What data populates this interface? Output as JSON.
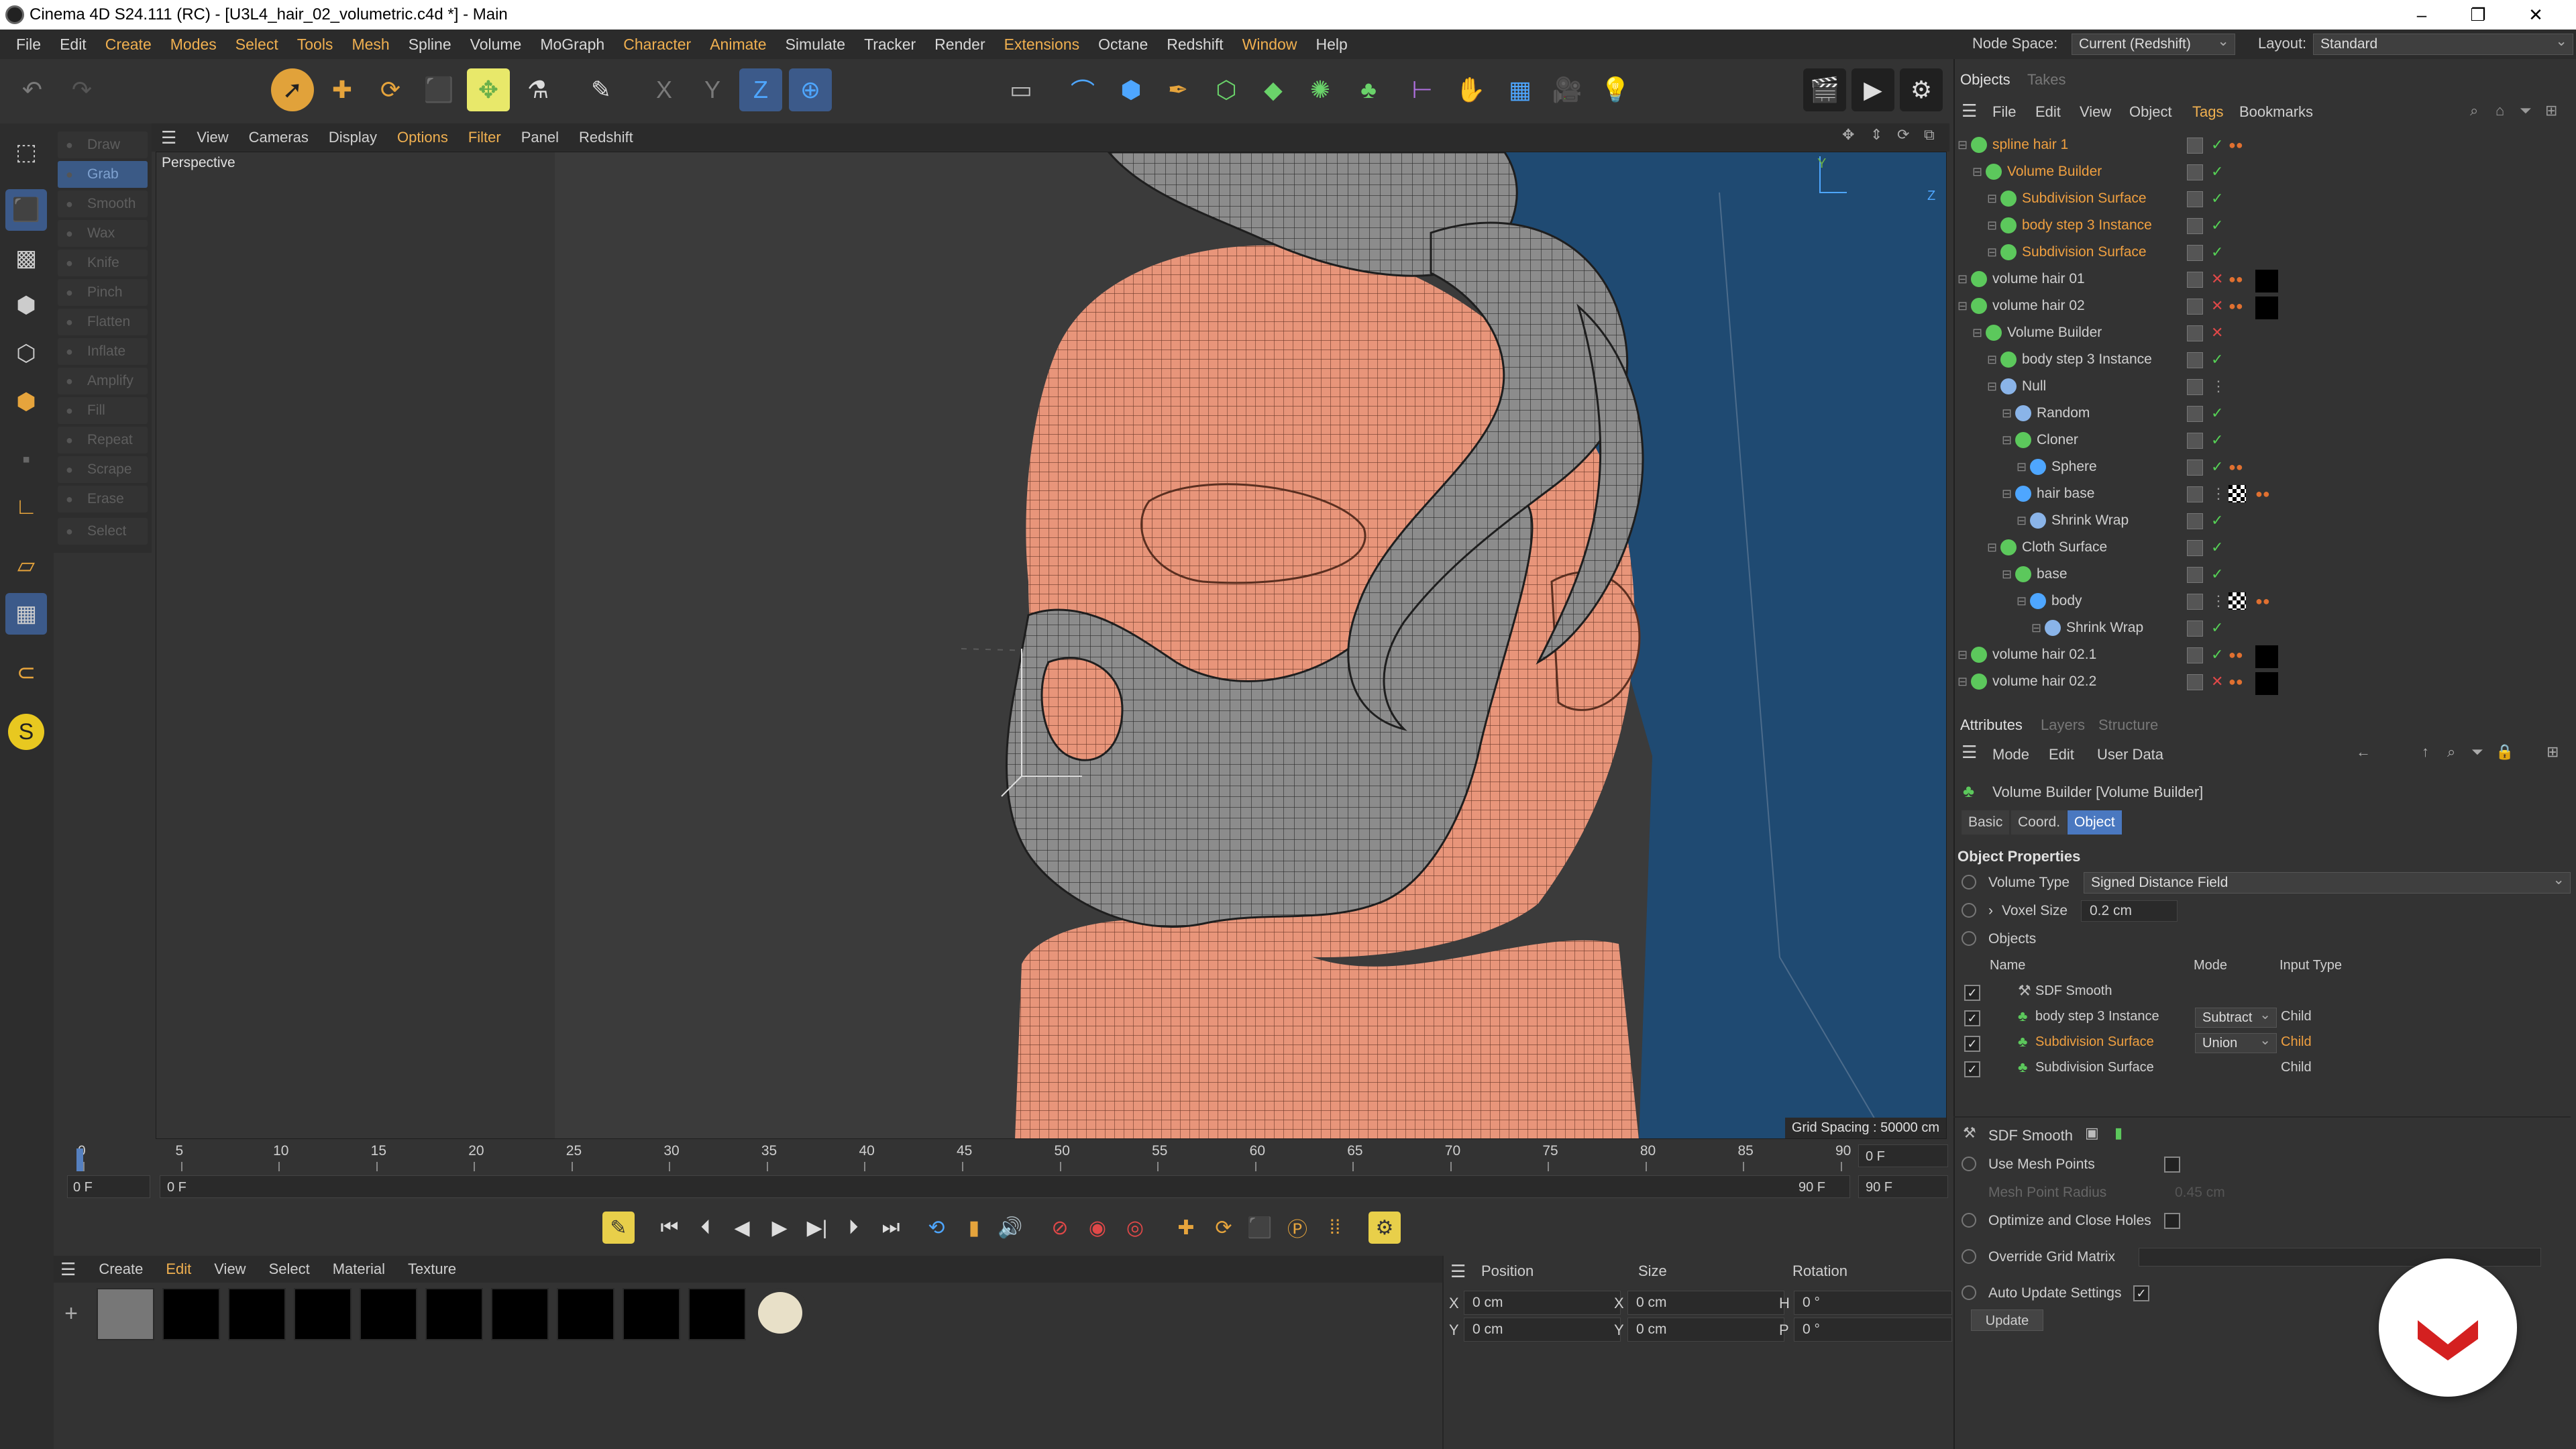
{
  "window": {
    "title": "Cinema 4D S24.111 (RC) - [U3L4_hair_02_volumetric.c4d *] - Main",
    "controls": [
      "–",
      "❐",
      "✕"
    ]
  },
  "menubar": {
    "items": [
      "File",
      "Edit",
      "Create",
      "Modes",
      "Select",
      "Tools",
      "Mesh",
      "Spline",
      "Volume",
      "MoGraph",
      "Character",
      "Animate",
      "Simulate",
      "Tracker",
      "Render",
      "Extensions",
      "Octane",
      "Redshift",
      "Window",
      "Help"
    ],
    "highlighted": [
      "Create",
      "Modes",
      "Character",
      "Extensions",
      "Window"
    ],
    "node_space_label": "Node Space:",
    "node_space_value": "Current (Redshift)",
    "layout_label": "Layout:",
    "layout_value": "Standard"
  },
  "sculpt_tools": [
    "Draw",
    "Grab",
    "Smooth",
    "Wax",
    "Knife",
    "Pinch",
    "Flatten",
    "Inflate",
    "Amplify",
    "Fill",
    "Repeat",
    "Scrape",
    "Erase",
    "Select"
  ],
  "viewport": {
    "menu": [
      "View",
      "Cameras",
      "Display",
      "Options",
      "Filter",
      "Panel",
      "Redshift"
    ],
    "menu_highlighted": [
      "Options",
      "Filter"
    ],
    "label": "Perspective",
    "grid_spacing": "Grid Spacing : 50000 cm",
    "axis_y": "Y",
    "axis_z": "Z"
  },
  "timeline": {
    "ticks": [
      "0",
      "5",
      "10",
      "15",
      "20",
      "25",
      "30",
      "35",
      "40",
      "45",
      "50",
      "55",
      "60",
      "65",
      "70",
      "75",
      "80",
      "85",
      "90"
    ],
    "current_frame": "0 F",
    "start_field": "0 F",
    "range_start": "0 F",
    "range_end": "90 F",
    "end_field": "90 F",
    "end_field2": "90 F"
  },
  "material_manager": {
    "menu": [
      "Create",
      "Edit",
      "View",
      "Select",
      "Material",
      "Texture"
    ],
    "menu_highlighted": [
      "Edit"
    ],
    "add_button": "+"
  },
  "coordinates": {
    "headers": [
      "Position",
      "Size",
      "Rotation"
    ],
    "rows": [
      {
        "axis1": "X",
        "pos": "0 cm",
        "axis2": "X",
        "size": "0 cm",
        "axis3": "H",
        "rot": "0 °"
      },
      {
        "axis1": "Y",
        "pos": "0 cm",
        "axis2": "Y",
        "size": "0 cm",
        "axis3": "P",
        "rot": "0 °"
      }
    ]
  },
  "object_manager": {
    "tabs": [
      "Objects",
      "Takes"
    ],
    "menu": [
      "File",
      "Edit",
      "View",
      "Object",
      "Tags",
      "Bookmarks"
    ],
    "menu_highlighted": [
      "Tags"
    ],
    "objects": [
      {
        "name": "spline hair 1",
        "indent": 0,
        "orange": true,
        "icon": "#5cc85c",
        "state": "check",
        "tags": [
          "dots"
        ]
      },
      {
        "name": "Volume Builder",
        "indent": 1,
        "orange": true,
        "icon": "#5cc85c",
        "state": "check",
        "tags": []
      },
      {
        "name": "Subdivision Surface",
        "indent": 2,
        "orange": true,
        "icon": "#5cc85c",
        "state": "check",
        "tags": []
      },
      {
        "name": "body step 3 Instance",
        "indent": 2,
        "orange": true,
        "icon": "#5cc85c",
        "state": "check",
        "tags": []
      },
      {
        "name": "Subdivision Surface",
        "indent": 2,
        "orange": true,
        "icon": "#5cc85c",
        "state": "check",
        "tags": []
      },
      {
        "name": "volume hair 01",
        "indent": 0,
        "orange": false,
        "icon": "#5cc85c",
        "state": "x",
        "tags": [
          "dots",
          "black"
        ]
      },
      {
        "name": "volume hair 02",
        "indent": 0,
        "orange": false,
        "icon": "#5cc85c",
        "state": "x",
        "tags": [
          "dots",
          "black"
        ]
      },
      {
        "name": "Volume Builder",
        "indent": 1,
        "orange": false,
        "icon": "#5cc85c",
        "state": "x",
        "tags": []
      },
      {
        "name": "body step 3 Instance",
        "indent": 2,
        "orange": false,
        "icon": "#5cc85c",
        "state": "check",
        "tags": []
      },
      {
        "name": "Null",
        "indent": 2,
        "orange": false,
        "icon": "#8ab4e8",
        "state": "none",
        "tags": []
      },
      {
        "name": "Random",
        "indent": 3,
        "orange": false,
        "icon": "#8ab4e8",
        "state": "check",
        "tags": []
      },
      {
        "name": "Cloner",
        "indent": 3,
        "orange": false,
        "icon": "#5cc85c",
        "state": "check",
        "tags": []
      },
      {
        "name": "Sphere",
        "indent": 4,
        "orange": false,
        "icon": "#4ea6ff",
        "state": "check",
        "tags": [
          "dots"
        ]
      },
      {
        "name": "hair base",
        "indent": 3,
        "orange": false,
        "icon": "#4ea6ff",
        "state": "none",
        "tags": [
          "checker",
          "dots"
        ]
      },
      {
        "name": "Shrink Wrap",
        "indent": 4,
        "orange": false,
        "icon": "#8ab4e8",
        "state": "check",
        "tags": []
      },
      {
        "name": "Cloth Surface",
        "indent": 2,
        "orange": false,
        "icon": "#5cc85c",
        "state": "check",
        "tags": []
      },
      {
        "name": "base",
        "indent": 3,
        "orange": false,
        "icon": "#5cc85c",
        "state": "check",
        "tags": []
      },
      {
        "name": "body",
        "indent": 4,
        "orange": false,
        "icon": "#4ea6ff",
        "state": "none",
        "tags": [
          "checker",
          "dots"
        ]
      },
      {
        "name": "Shrink Wrap",
        "indent": 5,
        "orange": false,
        "icon": "#8ab4e8",
        "state": "check",
        "tags": []
      },
      {
        "name": "volume hair 02.1",
        "indent": 0,
        "orange": false,
        "icon": "#5cc85c",
        "state": "check",
        "tags": [
          "dots",
          "black"
        ]
      },
      {
        "name": "volume hair 02.2",
        "indent": 0,
        "orange": false,
        "icon": "#5cc85c",
        "state": "x",
        "tags": [
          "dots",
          "black"
        ]
      }
    ]
  },
  "attributes": {
    "tabs": [
      "Attributes",
      "Layers",
      "Structure"
    ],
    "menu": [
      "Mode",
      "Edit",
      "User Data"
    ],
    "object_title": "Volume Builder [Volume Builder]",
    "subtabs": [
      "Basic",
      "Coord.",
      "Object"
    ],
    "active_subtab": "Object",
    "section": "Object Properties",
    "volume_type_label": "Volume Type",
    "volume_type_value": "Signed Distance Field",
    "voxel_size_label": "Voxel Size",
    "voxel_size_value": "0.2 cm",
    "objects_label": "Objects",
    "table_headers": [
      "Name",
      "Mode",
      "Input Type"
    ],
    "table_rows": [
      {
        "name": "SDF Smooth",
        "mode": "",
        "input": "",
        "orange": false
      },
      {
        "name": "body step 3 Instance",
        "mode": "Subtract",
        "input": "Child",
        "orange": false
      },
      {
        "name": "Subdivision Surface",
        "mode": "Union",
        "input": "Child",
        "orange": true
      },
      {
        "name": "Subdivision Surface",
        "mode": "",
        "input": "Child",
        "orange": false
      }
    ],
    "sdf_smooth_title": "SDF Smooth",
    "use_mesh_points": "Use Mesh Points",
    "mesh_point_radius": "Mesh Point Radius",
    "mesh_point_radius_value": "0.45 cm",
    "optimize": "Optimize and Close Holes",
    "override_grid": "Override Grid Matrix",
    "auto_update": "Auto Update Settings",
    "update_button": "Update"
  },
  "colors": {
    "accent_orange": "#f0a040",
    "selection_blue": "#4a78c0",
    "skin": "#e8957a",
    "hair": "#8c8c8c",
    "viewport_bg": "#3a3a3a",
    "viewport_blue": "#1f4a72"
  }
}
